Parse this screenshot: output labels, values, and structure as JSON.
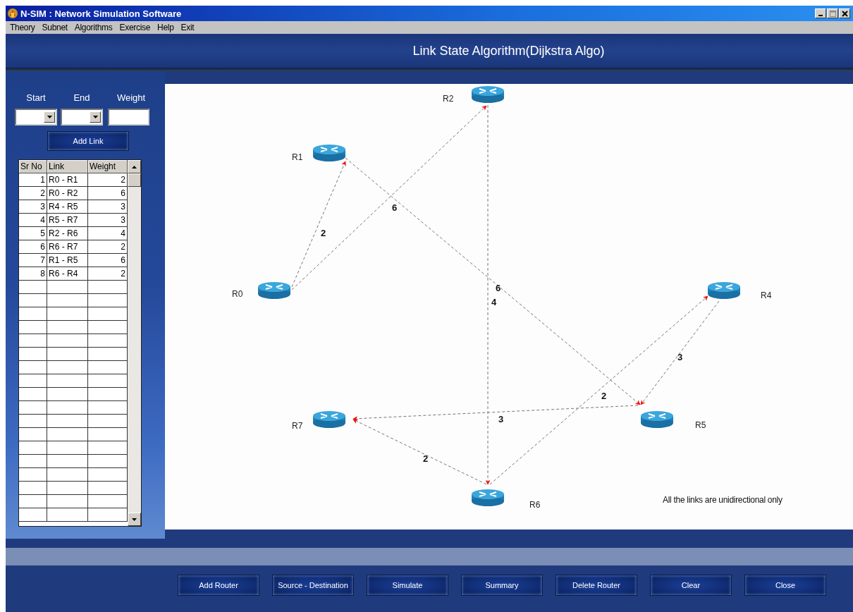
{
  "window": {
    "title": "N-SIM : Network Simulation Software"
  },
  "menu": [
    {
      "label": "Theory"
    },
    {
      "label": "Subnet"
    },
    {
      "label": "Algorithms"
    },
    {
      "label": "Exercise"
    },
    {
      "label": "Help"
    },
    {
      "label": "Exit"
    }
  ],
  "header": {
    "title": "Link State Algorithm(Dijkstra Algo)"
  },
  "link_form": {
    "start_label": "Start",
    "end_label": "End",
    "weight_label": "Weight",
    "add_button": "Add Link"
  },
  "table": {
    "columns": [
      "Sr No",
      "Link",
      "Weight"
    ],
    "rows": [
      [
        "1",
        "R0 - R1",
        "2"
      ],
      [
        "2",
        "R0 - R2",
        "6"
      ],
      [
        "3",
        "R4 - R5",
        "3"
      ],
      [
        "4",
        "R5 - R7",
        "3"
      ],
      [
        "5",
        "R2 - R6",
        "4"
      ],
      [
        "6",
        "R6 - R7",
        "2"
      ],
      [
        "7",
        "R1 - R5",
        "6"
      ],
      [
        "8",
        "R6 - R4",
        "2"
      ]
    ]
  },
  "canvas": {
    "routers": [
      {
        "label": "R0"
      },
      {
        "label": "R1"
      },
      {
        "label": "R2"
      },
      {
        "label": "R4"
      },
      {
        "label": "R5"
      },
      {
        "label": "R6"
      },
      {
        "label": "R7"
      }
    ],
    "links": [
      {
        "weight": "2"
      },
      {
        "weight": "6"
      },
      {
        "weight": "3"
      },
      {
        "weight": "3"
      },
      {
        "weight": "4"
      },
      {
        "weight": "2"
      },
      {
        "weight": "6"
      },
      {
        "weight": "2"
      }
    ],
    "note": "All the links are unidirectional only"
  },
  "buttons": [
    "Add Router",
    "Source - Destination",
    "Simulate",
    "Summary",
    "Delete Router",
    "Clear",
    "Close"
  ]
}
